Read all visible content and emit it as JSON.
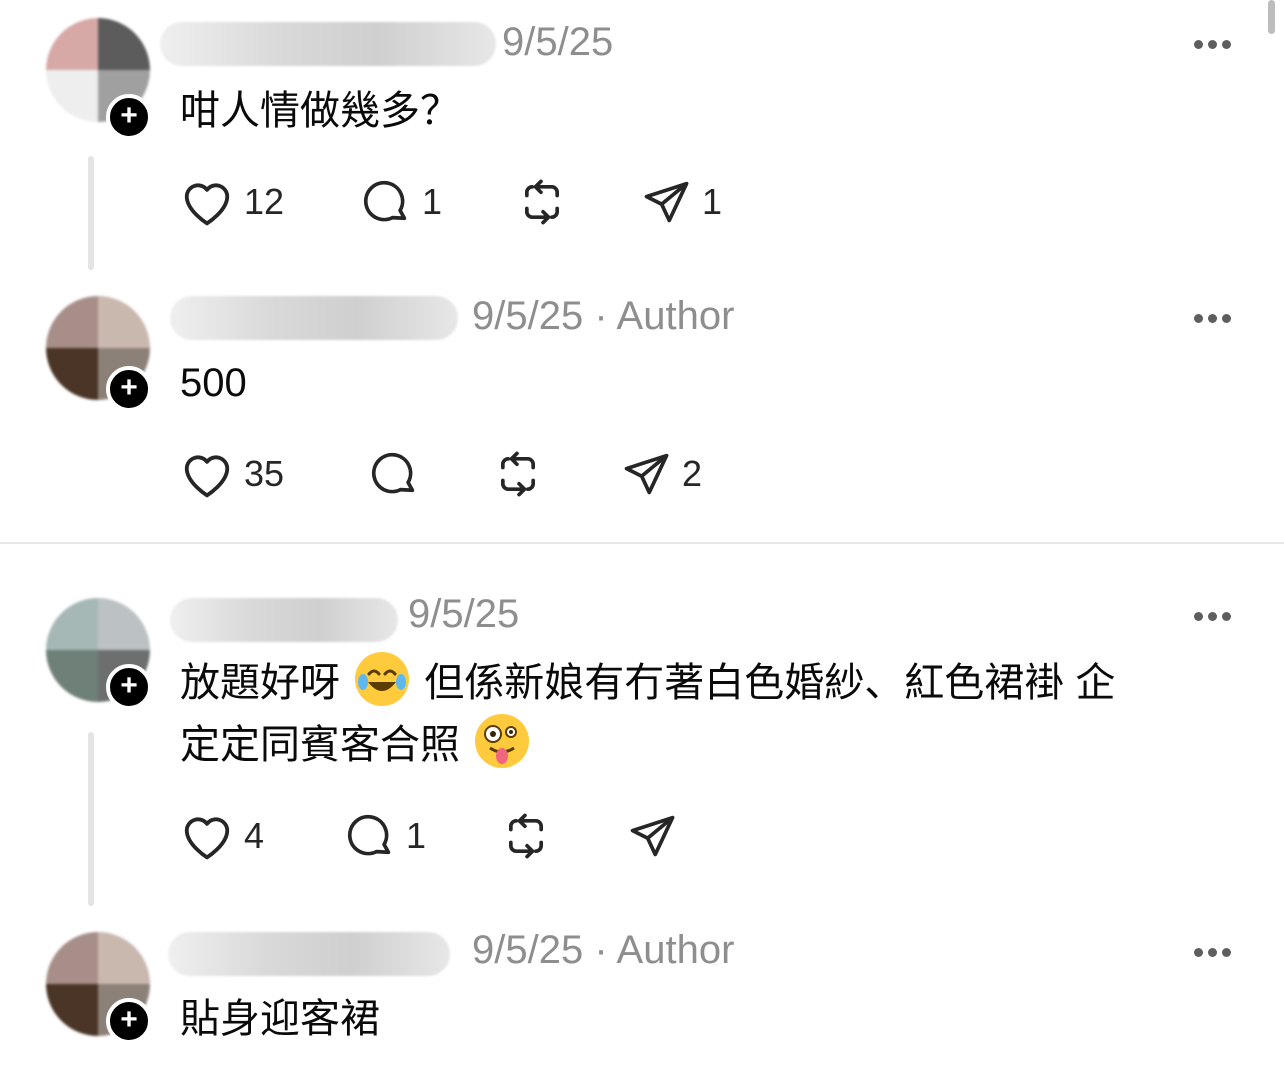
{
  "posts": [
    {
      "date": "9/5/25",
      "author_tag": "",
      "text": "咁人情做幾多？",
      "likes": "12",
      "replies": "1",
      "reposts": "",
      "shares": "1"
    },
    {
      "date": "9/5/25",
      "author_tag": " · Author",
      "text": "500",
      "likes": "35",
      "replies": "",
      "reposts": "",
      "shares": "2"
    },
    {
      "date": "9/5/25",
      "author_tag": "",
      "text_line1": "放題好呀",
      "text_line1b": "但係新娘有冇著白色婚紗、紅色裙褂 企",
      "text_line2": "定定同賓客合照",
      "likes": "4",
      "replies": "1",
      "reposts": "",
      "shares": ""
    },
    {
      "date": "9/5/25",
      "author_tag": " · Author",
      "text": "貼身迎客裙"
    }
  ],
  "icons": {
    "like": "heart-icon",
    "reply": "comment-icon",
    "repost": "repost-icon",
    "share": "send-icon",
    "more": "more-icon",
    "follow": "plus-icon"
  },
  "emojis": [
    "tears-of-joy-emoji",
    "zany-face-emoji"
  ]
}
